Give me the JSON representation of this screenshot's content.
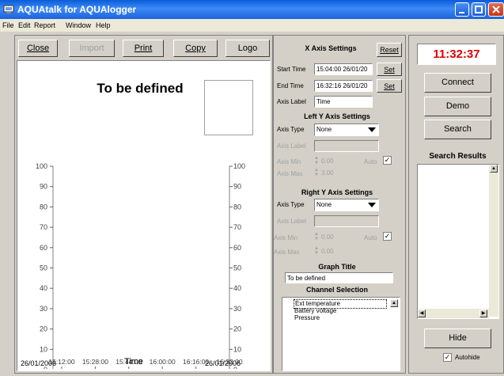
{
  "window": {
    "title": "AQUAtalk for AQUAlogger"
  },
  "menu": [
    "File",
    "Edit",
    "Report",
    "Window",
    "Help"
  ],
  "toolbar": {
    "close": "Close",
    "import": "Import",
    "print": "Print",
    "copy": "Copy",
    "logo": "Logo"
  },
  "graph": {
    "title": "To be defined",
    "xaxis_label": "Time",
    "start_date": "26/01/2006",
    "end_date": "26/01/2006"
  },
  "chart_data": {
    "type": "line",
    "title": "To be defined",
    "xlabel": "Time",
    "x_ticks": [
      "15:12:00",
      "15:28:00",
      "15:44:00",
      "16:00:00",
      "16:16:00",
      "16:32:00"
    ],
    "left_ticks": [
      "100",
      "90",
      "80",
      "70",
      "60",
      "50",
      "40",
      "30",
      "20",
      "10",
      "0"
    ],
    "right_ticks": [
      "100",
      "90",
      "80",
      "70",
      "60",
      "50",
      "40",
      "30",
      "20",
      "10",
      "0"
    ],
    "ylim": [
      0,
      100
    ],
    "grid": false,
    "series": []
  },
  "x_axis_settings": {
    "heading": "X Axis Settings",
    "reset": "Reset",
    "start_label": "Start Time",
    "start_value": "15:04:00 26/01/20",
    "end_label": "End Time",
    "end_value": "16:32:16 26/01/20",
    "set": "Set",
    "axis_label_label": "Axis Label",
    "axis_label_value": "Time"
  },
  "left_y": {
    "heading": "Left Y Axis Settings",
    "type_label": "Axis Type",
    "type_value": "None",
    "label_label": "Axis Label",
    "min_label": "Axis Min",
    "min_value": "0.00",
    "max_label": "Axis Max",
    "max_value": "3.00",
    "auto_label": "Auto",
    "auto_checked": true
  },
  "right_y": {
    "heading": "Right Y Axis Settings",
    "type_label": "Axis Type",
    "type_value": "None",
    "label_label": "Axis Label",
    "min_label": "Axis Min",
    "min_value": "0.00",
    "max_label": "Axis Max",
    "max_value": "0.00",
    "auto_label": "Auto",
    "auto_checked": true
  },
  "graph_title_section": {
    "heading": "Graph Title",
    "value": "To be defined"
  },
  "channels": {
    "heading": "Channel Selection",
    "items": [
      "Ext temperature",
      "Battery voltage",
      "Pressure"
    ]
  },
  "right_panel": {
    "clock": "11:32:37",
    "clock_color": "#e00000",
    "connect": "Connect",
    "demo": "Demo",
    "search": "Search",
    "search_results": "Search Results",
    "hide": "Hide",
    "autohide": "Autohide",
    "autohide_checked": true
  }
}
